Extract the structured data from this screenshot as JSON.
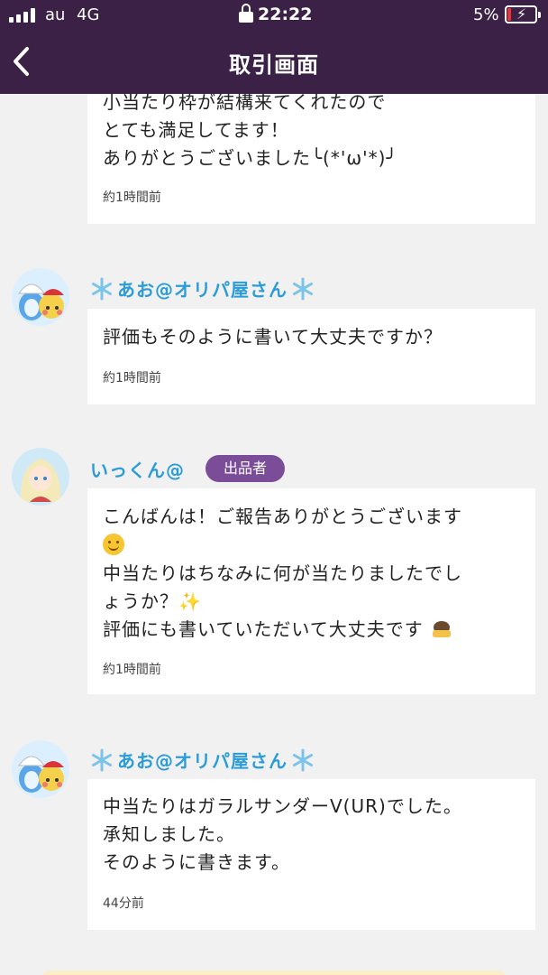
{
  "status_bar": {
    "carrier": "au",
    "network": "4G",
    "time": "22:22",
    "battery_percent": "5%"
  },
  "nav": {
    "title": "取引画面"
  },
  "messages": [
    {
      "lines": [
        "小当たり枠が結構来てくれたので",
        "とても満足してます！",
        "ありがとうございました╰(*'ω'*)╯"
      ],
      "time": "約1時間前"
    },
    {
      "sender": "あお@オリパ屋さん",
      "lines": [
        "評価もそのように書いて大丈夫ですか？"
      ],
      "time": "約1時間前"
    },
    {
      "sender": "いっくん@",
      "badge": "出品者",
      "lines": [
        "こんばんは！ご報告ありがとうございます",
        "中当たりはちなみに何が当たりましたでし",
        "ょうか？",
        "評価にも書いていただいて大丈夫です"
      ],
      "emoji": [
        "smiling-face",
        "sparkles",
        "person-bowing"
      ],
      "time": "約1時間前"
    },
    {
      "sender": "あお@オリパ屋さん",
      "lines": [
        "中当たりはガラルサンダーV(UR)でした。",
        "承知しました。",
        "そのように書きます。"
      ],
      "time": "44分前"
    }
  ],
  "colors": {
    "header_bg": "#3a2145",
    "name_blue": "#2b9cd8",
    "badge_purple": "#7b4c98",
    "page_bg": "#f1f1f1"
  }
}
